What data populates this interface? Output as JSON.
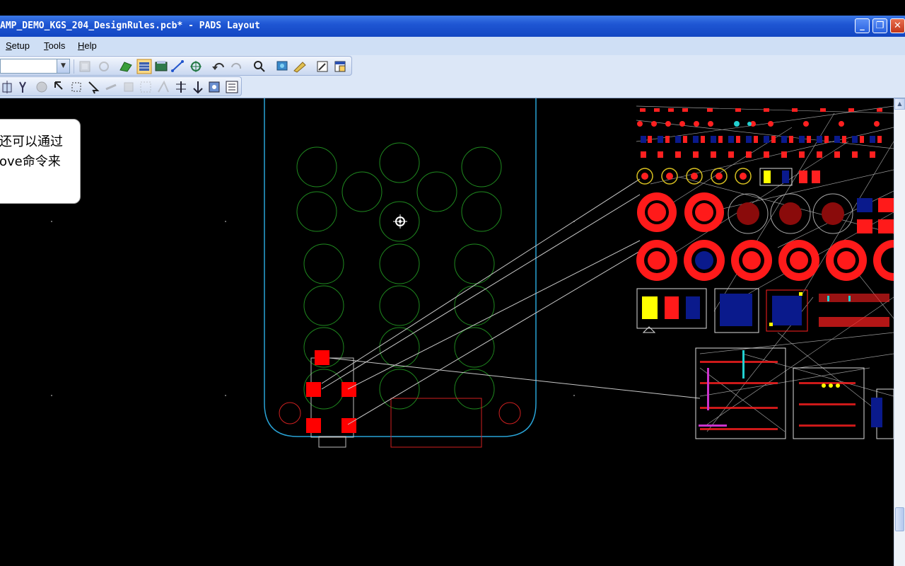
{
  "window": {
    "title": "AMP_DEMO_KGS_204_DesignRules.pcb* - PADS Layout",
    "minimize_glyph": "_",
    "maximize_glyph": "❐",
    "close_glyph": "✕"
  },
  "menu": {
    "items": [
      {
        "label": "Setup",
        "key": "S"
      },
      {
        "label": "Tools",
        "key": "T"
      },
      {
        "label": "Help",
        "key": "H"
      }
    ]
  },
  "toolbar": {
    "layer_combo_value": "",
    "row1_icons": [
      "properties-icon",
      "refresh-icon",
      "design-toolbar-icon",
      "drafting-toolbar-icon",
      "ecо-toolbar-icon",
      "route-icon",
      "bga-icon",
      "undo-icon",
      "redo-icon",
      "zoom-icon",
      "view-nets-icon",
      "display-colors-icon",
      "pan-icon",
      "window-icon"
    ],
    "row2_icons": [
      "move-icon",
      "move-by-ref-icon",
      "rotate-icon",
      "select-icon",
      "radial-move-icon",
      "select-mode-icon",
      "flip-icon",
      "spin-icon",
      "swap-icon",
      "cluster-icon",
      "union-icon",
      "align-icon",
      "distribute-icon",
      "placement-icon",
      "list-icon"
    ]
  },
  "tooltip": {
    "line1": "还可以通过",
    "line2": "ove命令来"
  },
  "colors": {
    "board_outline": "#29a3d6",
    "drill_circle": "#1f8a1f",
    "pad": "#ff0000",
    "ratsnest": "#c8c8c8",
    "pad_blue": "#0a1a8c",
    "pad_yellow": "#ffff00"
  }
}
